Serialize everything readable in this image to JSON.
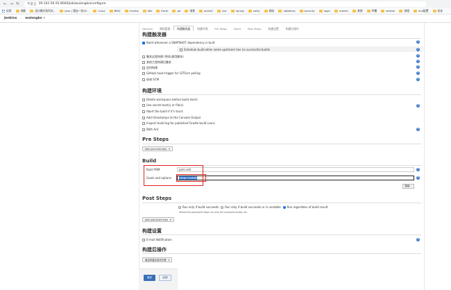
{
  "browser": {
    "url_prefix": "不安全",
    "url": "39.102.56.91:8040/job/wulongko/configure",
    "bookmarks": [
      "应用",
      "泡影",
      "设计模式系列文...",
      "Java | 我自一些GF...",
      "Linux",
      "BMQ",
      "Centos",
      "k8s",
      "Excel",
      "git",
      "电视",
      "activiti",
      "vue",
      "spring",
      "netty",
      "网站",
      "rabbitmq",
      "security",
      "login",
      "maven",
      "其他",
      "传播",
      "stream",
      "游戏",
      "ilua配置",
      "优化"
    ]
  },
  "jenkins": {
    "root": "Jenkins",
    "job": "wulongko"
  },
  "tabs": [
    "General",
    "源码管理",
    "构建触发器",
    "构建环境",
    "Pre Steps",
    "Build",
    "Post Steps",
    "构建设置",
    "构建后操作"
  ],
  "active_tab_index": 2,
  "triggers": {
    "title": "构建触发器",
    "items": [
      {
        "label": "Build whenever a SNAPSHOT dependency is built",
        "checked": true
      },
      {
        "label": "Schedule build when some upstream has no successful builds",
        "checked": false
      },
      {
        "label": "触发远程构建 (例如,使用脚本)",
        "checked": false
      },
      {
        "label": "其他工程构建后触发",
        "checked": false
      },
      {
        "label": "定时构建",
        "checked": false
      },
      {
        "label": "GitHub hook trigger for GITScm polling",
        "checked": false
      },
      {
        "label": "轮询 SCM",
        "checked": false
      }
    ]
  },
  "env": {
    "title": "构建环境",
    "items": [
      {
        "label": "Delete workspace before build starts"
      },
      {
        "label": "Use secret text(s) or file(s)"
      },
      {
        "label": "Abort the build if it's stuck"
      },
      {
        "label": "Add timestamps to the Console Output"
      },
      {
        "label": "Inspect build log for published Gradle build scans"
      },
      {
        "label": "With Ant"
      }
    ]
  },
  "pre_steps": {
    "title": "Pre Steps",
    "add_button": "Add pre-build step"
  },
  "build": {
    "title": "Build",
    "root_pom_label": "Root POM",
    "root_pom_value": "pom.xml",
    "goals_label": "Goals and options",
    "goals_value": "clean install",
    "advanced_button": "高级..."
  },
  "post_steps": {
    "title": "Post Steps",
    "options": [
      {
        "label": "Run only if build succeeds",
        "checked": false
      },
      {
        "label": "Run only if build succeeds or is unstable",
        "checked": false
      },
      {
        "label": "Run regardless of build result",
        "checked": true
      }
    ],
    "note": "Should the post-build steps run only for successful builds, etc.",
    "add_button": "Add post-build step"
  },
  "settings": {
    "title": "构建设置",
    "email_label": "E-mail Notification"
  },
  "post_build": {
    "title": "构建后操作",
    "add_button": "增加构建后操作步骤"
  },
  "actions": {
    "save": "保存",
    "apply": "应用"
  },
  "colors": {
    "accent": "#3a6fb7",
    "highlight": "#e02020",
    "help": "#3a78c9"
  }
}
